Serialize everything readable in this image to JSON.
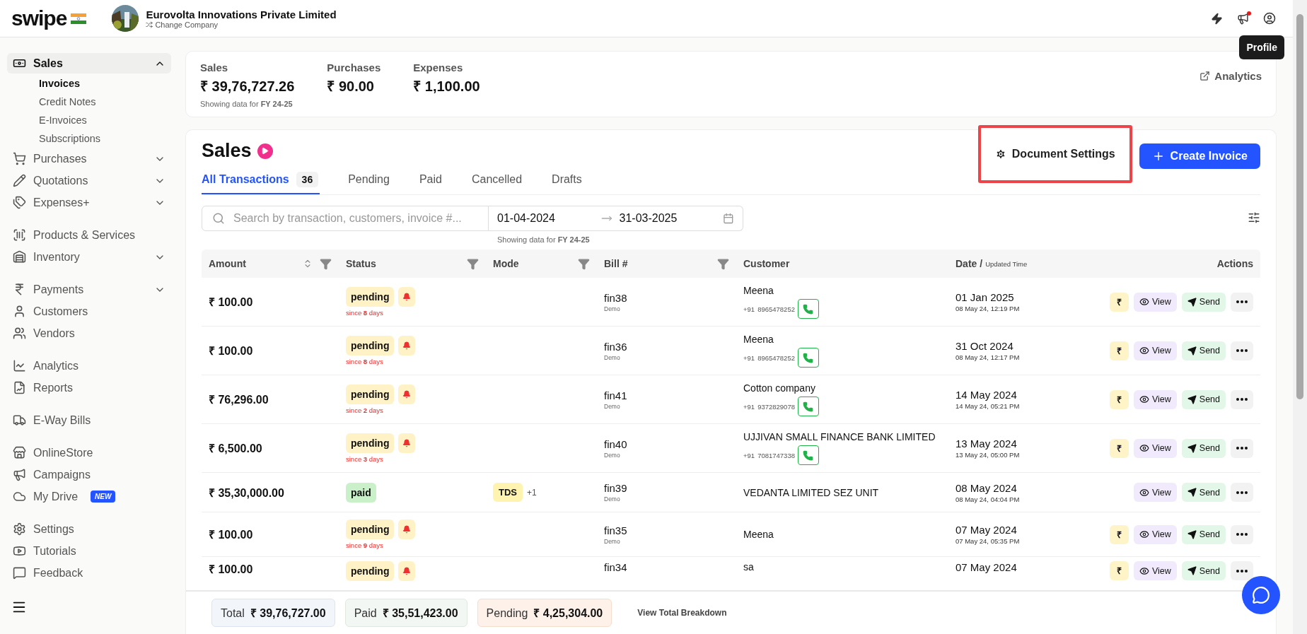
{
  "header": {
    "logo": "swipe",
    "company": {
      "name": "Eurovolta Innovations Private Limited",
      "switch": "Change Company"
    },
    "announcements_unread": true,
    "tooltip": "Profile"
  },
  "sidebar": {
    "groups": [
      [
        {
          "label": "Sales",
          "kind": "menu",
          "selected": true,
          "expanded": true,
          "children": [
            {
              "label": "Invoices",
              "selected": true
            },
            {
              "label": "Credit Notes",
              "selected": false
            },
            {
              "label": "E-Invoices",
              "selected": false
            },
            {
              "label": "Subscriptions",
              "selected": false
            }
          ]
        },
        {
          "label": "Purchases",
          "kind": "menu",
          "selected": false,
          "expanded": false
        },
        {
          "label": "Quotations",
          "kind": "menu",
          "selected": false,
          "expanded": false
        },
        {
          "label": "Expenses+",
          "kind": "menu",
          "selected": false,
          "expanded": false
        }
      ],
      [
        {
          "label": "Products & Services",
          "kind": "link",
          "selected": false
        },
        {
          "label": "Inventory",
          "kind": "menu",
          "selected": false,
          "expanded": false
        }
      ],
      [
        {
          "label": "Payments",
          "kind": "menu",
          "selected": false,
          "expanded": false
        },
        {
          "label": "Customers",
          "kind": "link",
          "selected": false
        },
        {
          "label": "Vendors",
          "kind": "link",
          "selected": false
        }
      ],
      [
        {
          "label": "Analytics",
          "kind": "link",
          "selected": false
        },
        {
          "label": "Reports",
          "kind": "link",
          "selected": false
        }
      ],
      [
        {
          "label": "E-Way Bills",
          "kind": "link",
          "selected": false
        }
      ],
      [
        {
          "label": "OnlineStore",
          "kind": "link",
          "selected": false
        },
        {
          "label": "Campaigns",
          "kind": "link",
          "selected": false
        },
        {
          "label": "My Drive",
          "kind": "link",
          "selected": false,
          "badge": "NEW"
        }
      ],
      [
        {
          "label": "Settings",
          "kind": "link",
          "selected": false
        },
        {
          "label": "Tutorials",
          "kind": "link",
          "selected": false
        },
        {
          "label": "Feedback",
          "kind": "link",
          "selected": false
        }
      ]
    ]
  },
  "summary": {
    "stats": [
      {
        "label": "Sales",
        "value": "₹ 39,76,727.26",
        "note": "Showing data for **FY 24-25**"
      },
      {
        "label": "Purchases",
        "value": "₹ 90.00"
      },
      {
        "label": "Expenses",
        "value": "₹ 1,100.00"
      }
    ],
    "analytics_link": "Analytics"
  },
  "sales": {
    "title": "Sales",
    "document_settings": "Document Settings",
    "create_button": "Create Invoice",
    "tabs": [
      {
        "label": "All Transactions",
        "count": "36",
        "selected": true
      },
      {
        "label": "Pending",
        "selected": false
      },
      {
        "label": "Paid",
        "selected": false
      },
      {
        "label": "Cancelled",
        "selected": false
      },
      {
        "label": "Drafts",
        "selected": false
      }
    ],
    "search": {
      "placeholder": "Search by transaction, customers, invoice #..."
    },
    "date_range": {
      "from": "01-04-2024",
      "to": "31-03-2025",
      "note": "Showing data for **FY 24-25**"
    },
    "table": {
      "columns": [
        {
          "label": "Amount",
          "sortable": true,
          "filter": true
        },
        {
          "label": "Status",
          "sortable": false,
          "filter": true
        },
        {
          "label": "Mode",
          "sortable": false,
          "filter": true
        },
        {
          "label": "Bill #",
          "sortable": false,
          "filter": true
        },
        {
          "label": "Customer",
          "sortable": false,
          "filter": false
        },
        {
          "label": "Date /",
          "sub": "Updated Time",
          "sortable": false,
          "filter": false
        },
        {
          "label": "Actions",
          "sortable": false,
          "filter": false
        }
      ],
      "rows": [
        {
          "amount": "₹ 100.00",
          "status": "pending",
          "since": "since **8** days",
          "bill": "fin38",
          "bill_note": "Demo",
          "customer": "Meena",
          "phone_code": "+91",
          "phone": "8965478252",
          "date": "01 Jan 2025",
          "time": "08 May 24, 12:19 PM",
          "pay": "₹",
          "view": "View",
          "send": "Send"
        },
        {
          "amount": "₹ 100.00",
          "status": "pending",
          "since": "since **8** days",
          "bill": "fin36",
          "bill_note": "Demo",
          "customer": "Meena",
          "phone_code": "+91",
          "phone": "8965478252",
          "date": "31 Oct 2024",
          "time": "08 May 24, 12:17 PM",
          "pay": "₹",
          "view": "View",
          "send": "Send"
        },
        {
          "amount": "₹ 76,296.00",
          "status": "pending",
          "since": "since **2** days",
          "bill": "fin41",
          "bill_note": "Demo",
          "customer": "Cotton company",
          "phone_code": "+91",
          "phone": "9372829078",
          "date": "14 May 2024",
          "time": "14 May 24, 05:21 PM",
          "pay": "₹",
          "view": "View",
          "send": "Send"
        },
        {
          "amount": "₹ 6,500.00",
          "status": "pending",
          "since": "since **3** days",
          "bill": "fin40",
          "bill_note": "Demo",
          "customer": "UJJIVAN SMALL FINANCE BANK LIMITED",
          "phone_code": "+91",
          "phone": "7081747338",
          "date": "13 May 2024",
          "time": "13 May 24, 05:00 PM",
          "pay": "₹",
          "view": "View",
          "send": "Send"
        },
        {
          "amount": "₹ 35,30,000.00",
          "status": "paid",
          "mode": "TDS",
          "mode_more": "+1",
          "bill": "fin39",
          "bill_note": "Demo",
          "customer": "VEDANTA LIMITED SEZ UNIT",
          "date": "08 May 2024",
          "time": "08 May 24, 04:04 PM",
          "view": "View",
          "send": "Send"
        },
        {
          "amount": "₹ 100.00",
          "status": "pending",
          "since": "since **9** days",
          "bill": "fin35",
          "bill_note": "Demo",
          "customer": "Meena",
          "date": "07 May 2024",
          "time": "07 May 24, 05:35 PM",
          "pay": "₹",
          "view": "View",
          "send": "Send"
        },
        {
          "amount": "₹ 100.00",
          "status": "pending",
          "bill": "fin34",
          "customer": "sa",
          "date": "07 May 2024",
          "pay": "₹",
          "view": "View",
          "send": "Send"
        }
      ]
    },
    "totals": [
      {
        "kind": "total",
        "label": "Total",
        "value": "₹ 39,76,727.00"
      },
      {
        "kind": "paid",
        "label": "Paid",
        "value": "₹ 35,51,423.00"
      },
      {
        "kind": "pending",
        "label": "Pending",
        "value": "₹ 4,25,304.00"
      }
    ],
    "breakdown_link": "View Total Breakdown"
  }
}
